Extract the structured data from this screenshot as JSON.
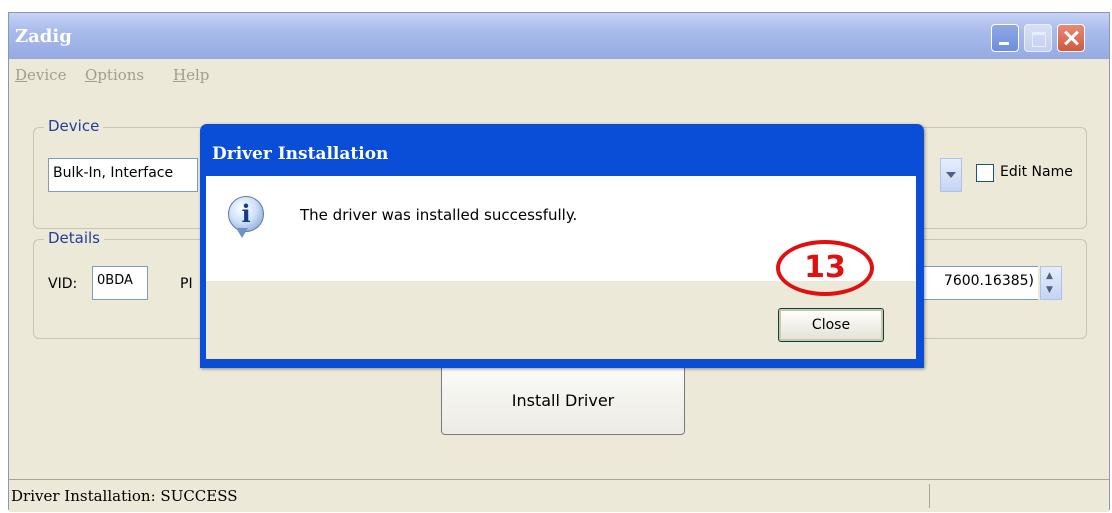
{
  "window": {
    "title": "Zadig"
  },
  "menu": {
    "items": [
      "Device",
      "Options",
      "Help"
    ]
  },
  "device_group": {
    "label": "Device",
    "selected_device": "Bulk-In, Interface",
    "edit_name_label": "Edit Name",
    "edit_name_checked": false
  },
  "details_group": {
    "label": "Details",
    "vid_label": "VID:",
    "vid_value": "0BDA",
    "pid_label_partial": "PI",
    "driver_version_partial": "7600.16385)"
  },
  "install_button": {
    "label": "Install Driver"
  },
  "status_bar": {
    "text": "Driver Installation: SUCCESS"
  },
  "dialog": {
    "title": "Driver Installation",
    "message": "The driver was installed successfully.",
    "close_label": "Close",
    "icon": "info-icon"
  },
  "annotation": {
    "step_number": "13",
    "color": "#e01010"
  }
}
